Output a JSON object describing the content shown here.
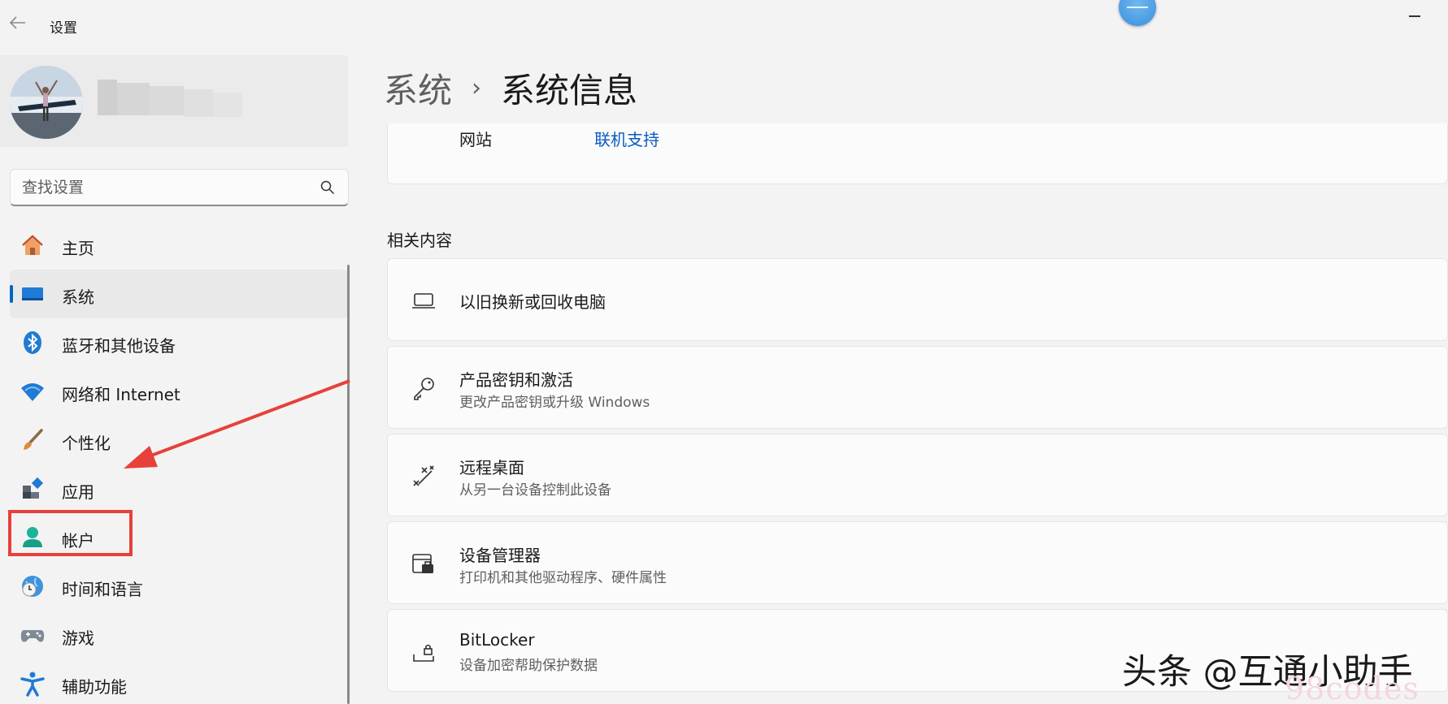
{
  "window": {
    "title": "设置"
  },
  "profile": {
    "avatar_label": "user-avatar"
  },
  "search": {
    "placeholder": "查找设置"
  },
  "sidebar": {
    "items": [
      {
        "label": "主页",
        "icon": "home-icon",
        "active": false
      },
      {
        "label": "系统",
        "icon": "system-icon",
        "active": true
      },
      {
        "label": "蓝牙和其他设备",
        "icon": "bluetooth-icon",
        "active": false
      },
      {
        "label": "网络和 Internet",
        "icon": "wifi-icon",
        "active": false
      },
      {
        "label": "个性化",
        "icon": "brush-icon",
        "active": false
      },
      {
        "label": "应用",
        "icon": "apps-icon",
        "active": false
      },
      {
        "label": "帐户",
        "icon": "account-icon",
        "active": false
      },
      {
        "label": "时间和语言",
        "icon": "time-language-icon",
        "active": false
      },
      {
        "label": "游戏",
        "icon": "gamepad-icon",
        "active": false
      },
      {
        "label": "辅助功能",
        "icon": "accessibility-icon",
        "active": false
      }
    ]
  },
  "breadcrumb": {
    "parent": "系统",
    "separator": "›",
    "current": "系统信息"
  },
  "spec_card": {
    "key": "网站",
    "value": "联机支持"
  },
  "related": {
    "title": "相关内容",
    "items": [
      {
        "title": "以旧换新或回收电脑",
        "subtitle": "",
        "icon": "laptop-icon"
      },
      {
        "title": "产品密钥和激活",
        "subtitle": "更改产品密钥或升级 Windows",
        "icon": "key-icon"
      },
      {
        "title": "远程桌面",
        "subtitle": "从另一台设备控制此设备",
        "icon": "remote-desktop-icon"
      },
      {
        "title": "设备管理器",
        "subtitle": "打印机和其他驱动程序、硬件属性",
        "icon": "device-manager-icon"
      },
      {
        "title": "BitLocker",
        "subtitle": "设备加密帮助保护数据",
        "icon": "lock-icon"
      }
    ]
  },
  "watermark": {
    "text": "头条 @互通小助手",
    "site": "98codes"
  },
  "colors": {
    "accent": "#0067c0",
    "annotation_red": "#e8403a",
    "link": "#0a5ac5"
  }
}
